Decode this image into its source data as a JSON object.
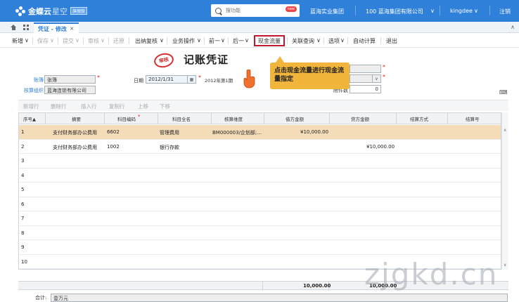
{
  "app": {
    "brand_name": "金蝶云",
    "brand_sub": "星空",
    "brand_badge": "旗舰版",
    "search_placeholder": "搜功能",
    "search_badge": "new",
    "org_group": "蓝海实业集团",
    "company": "100 蓝海集团有限公司",
    "user": "kingdee",
    "logout": "注销"
  },
  "tab": {
    "label": "凭证 - 修改",
    "close": "×"
  },
  "toolbar": {
    "items": [
      "新增",
      "保存",
      "提交",
      "审核",
      "还原",
      "出纳复核",
      "业务操作",
      "前一",
      "后一",
      "现金流量",
      "关联查询",
      "选项",
      "自动计算",
      "退出"
    ]
  },
  "voucher": {
    "stamp": "审核",
    "title": "记账凭证",
    "book_label": "账簿",
    "book_value": "张簿",
    "acct_org_label": "核算组织",
    "acct_org_value": "蓝海连锁有限公司",
    "date_label": "日期",
    "date_value": "2012/1/31",
    "period_text": "2012年第1期",
    "attachments_label": "附件数",
    "attachments_value": "0"
  },
  "callout": {
    "text": "点击现金流量进行现金流量指定"
  },
  "grid_toolbar": [
    "新增行",
    "删除行",
    "插入行",
    "复制行",
    "上移",
    "下移"
  ],
  "grid": {
    "headers": [
      "序号▲",
      "摘要",
      "科目编码",
      "科目全名",
      "核算维度",
      "借方金额",
      "贷方金额",
      "结算方式",
      "结算号"
    ],
    "rows": [
      {
        "no": "1",
        "summary": "支付财务部办公费用",
        "code": "6602",
        "name": "管理费用",
        "dim": "BM000003/企划部;...",
        "debit": "¥10,000.00",
        "credit": ""
      },
      {
        "no": "2",
        "summary": "支付财务部办公费用",
        "code": "1002",
        "name": "银行存款",
        "dim": "",
        "debit": "",
        "credit": "¥10,000.00"
      },
      {
        "no": "3",
        "summary": "",
        "code": "",
        "name": "",
        "dim": "",
        "debit": "",
        "credit": ""
      },
      {
        "no": "4",
        "summary": "",
        "code": "",
        "name": "",
        "dim": "",
        "debit": "",
        "credit": ""
      },
      {
        "no": "5",
        "summary": "",
        "code": "",
        "name": "",
        "dim": "",
        "debit": "",
        "credit": ""
      },
      {
        "no": "6",
        "summary": "",
        "code": "",
        "name": "",
        "dim": "",
        "debit": "",
        "credit": ""
      },
      {
        "no": "7",
        "summary": "",
        "code": "",
        "name": "",
        "dim": "",
        "debit": "",
        "credit": ""
      },
      {
        "no": "8",
        "summary": "",
        "code": "",
        "name": "",
        "dim": "",
        "debit": "",
        "credit": ""
      },
      {
        "no": "9",
        "summary": "",
        "code": "",
        "name": "",
        "dim": "",
        "debit": "",
        "credit": ""
      },
      {
        "no": "10",
        "summary": "",
        "code": "",
        "name": "",
        "dim": "",
        "debit": "",
        "credit": ""
      }
    ],
    "total_debit": "10,000.00",
    "total_credit": "10,000.00"
  },
  "footer": {
    "total_label": "合计:",
    "total_words": "壹万元"
  },
  "watermark": "zjgkd.cn",
  "colors": {
    "brand_blue": "#2f80d9",
    "highlight_red": "#c0182c",
    "callout_orange": "#f2b53b",
    "selected_row": "#f5dcb8"
  }
}
